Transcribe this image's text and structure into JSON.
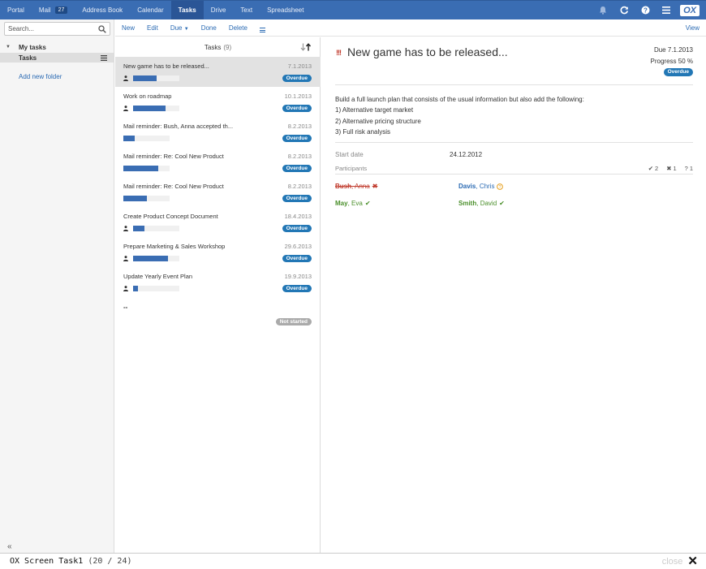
{
  "topnav": {
    "apps": [
      {
        "label": "Portal"
      },
      {
        "label": "Mail",
        "badge": "27"
      },
      {
        "label": "Address Book"
      },
      {
        "label": "Calendar"
      },
      {
        "label": "Tasks",
        "active": true
      },
      {
        "label": "Drive"
      },
      {
        "label": "Text"
      },
      {
        "label": "Spreadsheet"
      }
    ],
    "icons": [
      "bell-icon",
      "refresh-icon",
      "help-icon",
      "menu-icon"
    ],
    "logo": "OX"
  },
  "sidebar": {
    "search_placeholder": "Search...",
    "root_folder": "My tasks",
    "folder": "Tasks",
    "add_folder": "Add new folder",
    "collapse": "«"
  },
  "toolbar": {
    "new": "New",
    "edit": "Edit",
    "due": "Due",
    "done": "Done",
    "delete": "Delete",
    "view": "View"
  },
  "list": {
    "header": "Tasks",
    "count": "(9)",
    "items": [
      {
        "title": "New game has to be released...",
        "date": "7.1.2013",
        "progress": 50,
        "person": true,
        "status": "Overdue"
      },
      {
        "title": "Work on roadmap",
        "date": "10.1.2013",
        "progress": 70,
        "person": true,
        "status": "Overdue"
      },
      {
        "title": "Mail reminder: Bush, Anna accepted th...",
        "date": "8.2.2013",
        "progress": 25,
        "person": false,
        "status": "Overdue"
      },
      {
        "title": "Mail reminder: Re: Cool New Product",
        "date": "8.2.2013",
        "progress": 75,
        "person": false,
        "status": "Overdue"
      },
      {
        "title": "Mail reminder: Re: Cool New Product",
        "date": "8.2.2013",
        "progress": 50,
        "person": false,
        "status": "Overdue"
      },
      {
        "title": "Create Product Concept Document",
        "date": "18.4.2013",
        "progress": 25,
        "person": true,
        "status": "Overdue"
      },
      {
        "title": "Prepare Marketing & Sales Workshop",
        "date": "29.6.2013",
        "progress": 75,
        "person": true,
        "status": "Overdue"
      },
      {
        "title": "Update Yearly Event Plan",
        "date": "19.9.2013",
        "progress": 10,
        "person": true,
        "status": "Overdue"
      },
      {
        "title": "--",
        "date": "",
        "progress": null,
        "person": false,
        "status": "Not started"
      }
    ]
  },
  "detail": {
    "priority": "!!!",
    "title": "New game has to be released...",
    "due": "Due 7.1.2013",
    "progress": "Progress 50 %",
    "status": "Overdue",
    "description": [
      "Build a full launch plan that consists of the usual information but also add the following:",
      "1) Alternative target market",
      "2) Alternative pricing structure",
      "3) Full risk analysis"
    ],
    "start_date_label": "Start date",
    "start_date": "24.12.2012",
    "participants_label": "Participants",
    "counts": {
      "accepted": "2",
      "declined": "1",
      "tentative": "1"
    },
    "participants": [
      {
        "last": "Bush",
        "first": "Anna",
        "status": "declined"
      },
      {
        "last": "Davis",
        "first": "Chris",
        "status": "tentative"
      },
      {
        "last": "May",
        "first": "Eva",
        "status": "accepted"
      },
      {
        "last": "Smith",
        "first": "David",
        "status": "accepted"
      }
    ]
  },
  "bottombar": {
    "label": "OX Screen Task1",
    "counter": "(20 / 24)",
    "close": "close"
  },
  "colors": {
    "topbar": "#3a6db3",
    "accent": "#2a6ab3",
    "overdue": "#2277b5",
    "declined": "#c0392b",
    "accepted": "#4a8f2a"
  }
}
